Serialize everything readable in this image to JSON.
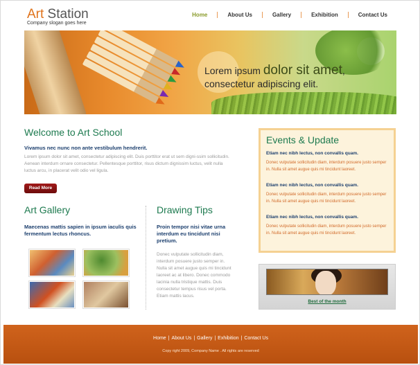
{
  "header": {
    "logo_part1": "Art",
    "logo_part2": " Station",
    "slogan": "Company slogan goes here",
    "nav": [
      "Home",
      "About Us",
      "Gallery",
      "Exhibition",
      "Contact Us"
    ]
  },
  "banner": {
    "line1_small": "Lorem ipsum ",
    "line1_big": "dolor sit amet",
    "line1_end": ",",
    "line2": "consectetur adipiscing elit."
  },
  "welcome": {
    "title": "Welcome to Art School",
    "subtitle": "Vivamus nec nunc non ante vestibulum hendrerit.",
    "body": "Lorem ipsum dolor sit amet, consectetur adipiscing elit. Duis porttitor erat ut sem digni-ssim sollicitudin. Aenean interdum ornare consectetur. Pellentesque porttitor, risus dictum dignissim luctus, velit nulla luctus arcu, in placerat velit odio vel ligula.",
    "read_more": "Read More"
  },
  "gallery": {
    "title": "Art Gallery",
    "subtitle": "Maecenas mattis sapien in ipsum iaculis quis fermentum lectus rhoncus."
  },
  "tips": {
    "title": "Drawing Tips",
    "subtitle": "Proin tempor nisi vitae urna interdum eu tincidunt nisi pretium.",
    "body": "Donec vulputate sollicitudin diam, interdum posuere justo semper in. Nulla sit amet augue quis mi tincidunt laoreet ac at libero. Donec commodo lacinia nulla tristique mattis. Duis consectetur tempus risus vel porta. Etiam mattis lacus."
  },
  "events": {
    "title": "Events & Update",
    "items": [
      {
        "title": "Etiam nec nibh lectus, non convallis quam.",
        "desc": "Donec vulputate sollicitudin diam, interdum posuere justo semper in. Nulla sit amet augue quis mi tincidunt laoreet."
      },
      {
        "title": "Etiam nec nibh lectus, non convallis quam.",
        "desc": "Donec vulputate sollicitudin diam, interdum posuere justo semper in. Nulla sit amet augue quis mi tincidunt laoreet."
      },
      {
        "title": "Etiam nec nibh lectus, non convallis quam.",
        "desc": "Donec vulputate sollicitudin diam, interdum posuere justo semper in. Nulla sit amet augue quis mi tincidunt laoreet."
      }
    ]
  },
  "best": {
    "link": "Best of the month"
  },
  "footer": {
    "nav": [
      "Home",
      "About Us",
      "Gallery",
      "Exhibition",
      "Contact Us"
    ],
    "copyright": "Copy right 2009, Company Name . All rights are reserved"
  },
  "colors": {
    "accent_orange": "#e0731b",
    "heading_green": "#1d7a4f",
    "link_blue": "#1c3f6e",
    "footer": "#c45a17"
  }
}
